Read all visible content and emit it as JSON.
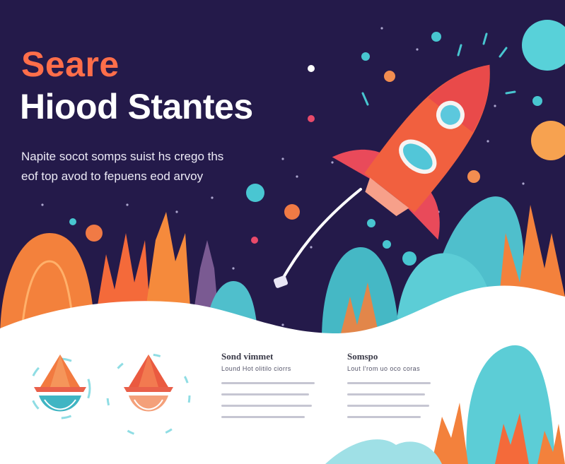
{
  "hero": {
    "kicker": "Seare",
    "headline": "Hiood Stantes",
    "body_lines": [
      "Napite socot somps suist hs crego ths",
      "eof top avod to fepuens eod arvoy"
    ]
  },
  "columns": [
    {
      "title": "Sond vimmet",
      "subtitle": "Lound Hot olitilo ciorrs"
    },
    {
      "title": "Somspo",
      "subtitle": "Lout I'rom uo oco coras"
    }
  ],
  "colors": {
    "night_sky": "#241a4a",
    "kicker": "#ff6e4a",
    "headline": "#ffffff",
    "rocket_body": "#f1603f",
    "rocket_window": "#52c6d8",
    "hills_teal": "#53c3cf",
    "hills_orange": "#f4803e",
    "ground": "#ffffff"
  },
  "icons": [
    "rocket-icon",
    "sailboat-icon",
    "sailboat-icon"
  ]
}
